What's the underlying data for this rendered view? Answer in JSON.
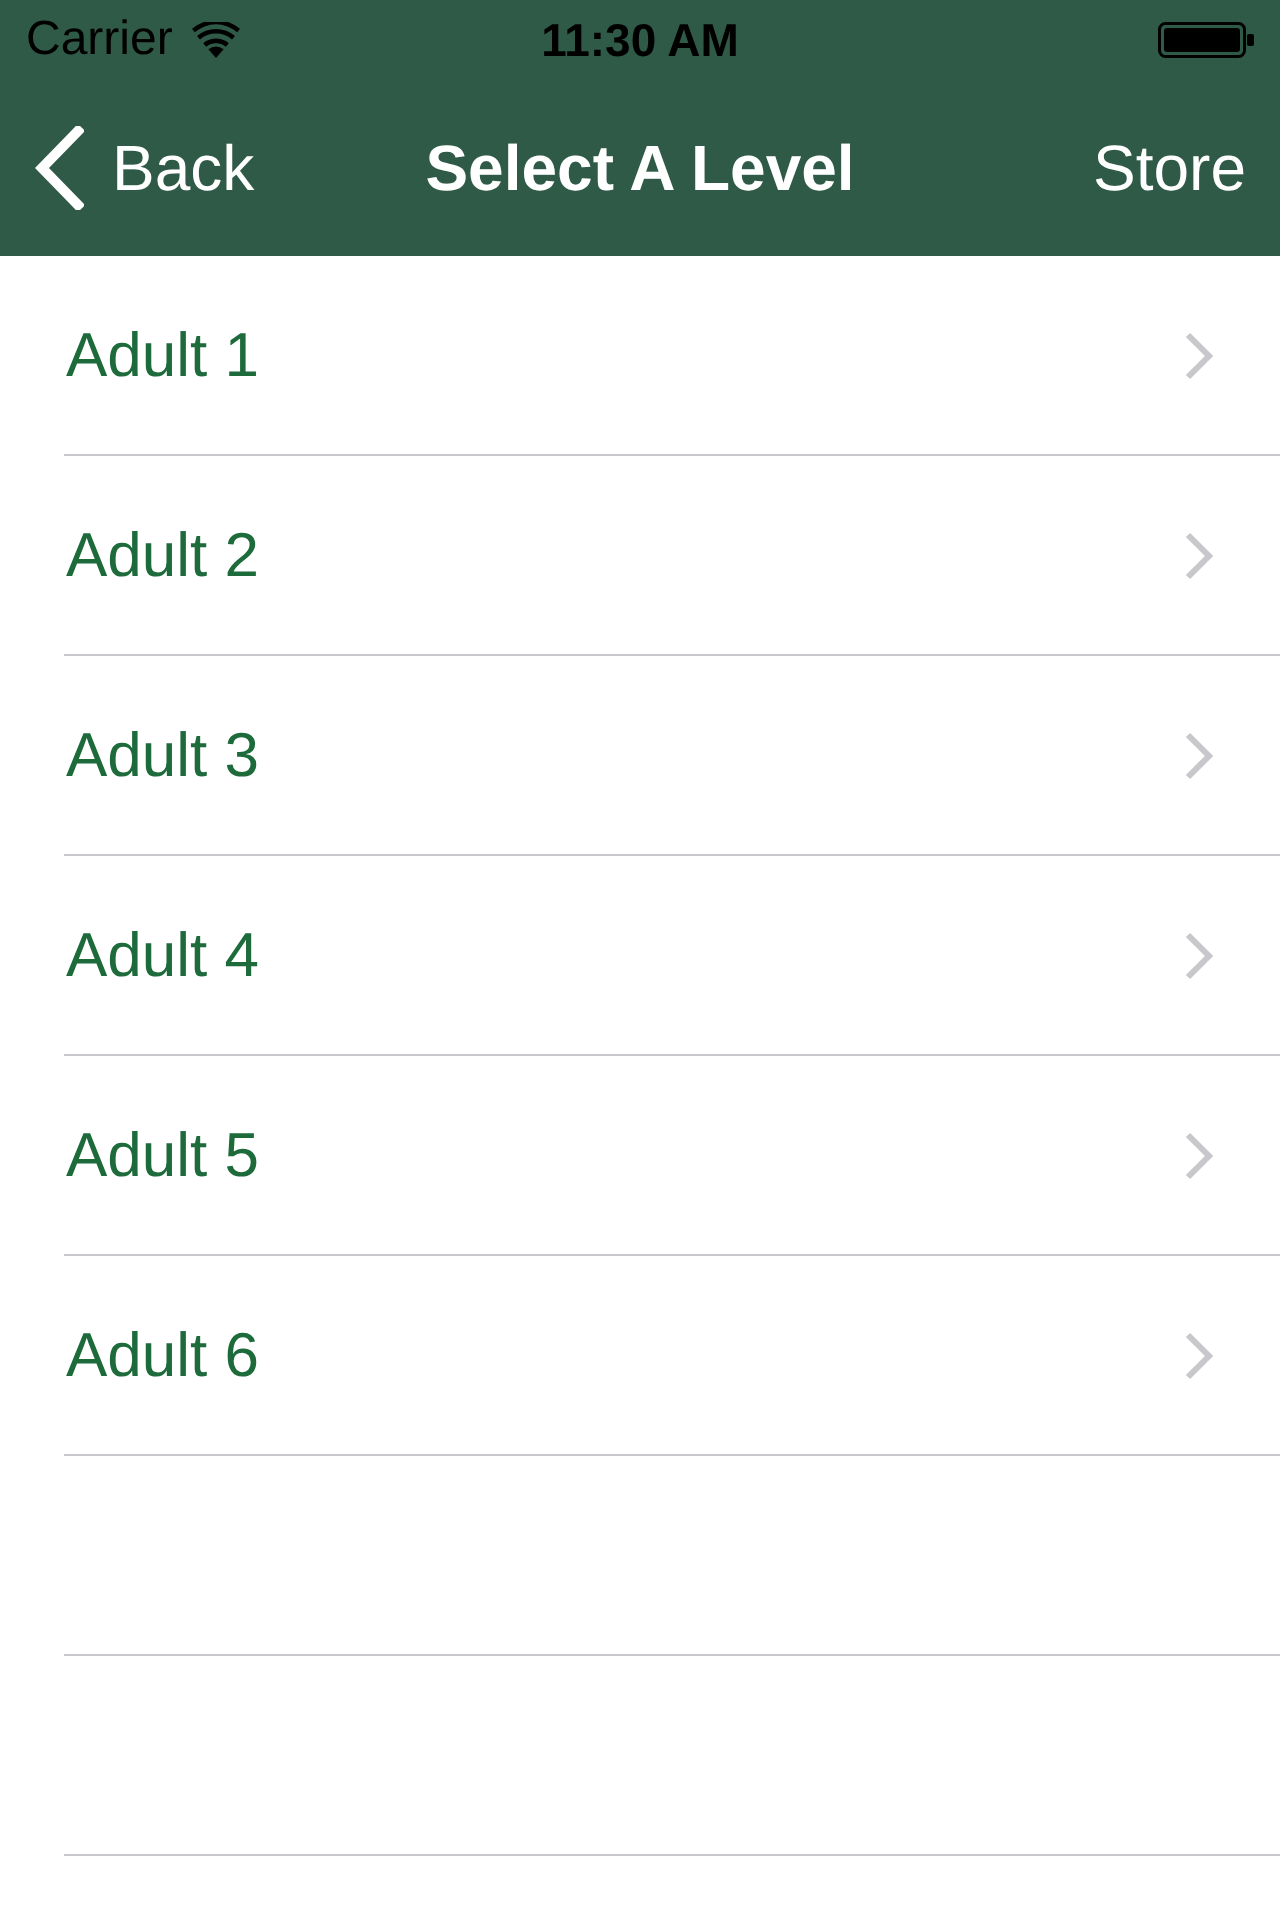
{
  "status_bar": {
    "carrier": "Carrier",
    "time": "11:30 AM"
  },
  "nav_bar": {
    "back": "Back",
    "title": "Select A Level",
    "action": "Store"
  },
  "levels": [
    {
      "label": "Adult 1"
    },
    {
      "label": "Adult 2"
    },
    {
      "label": "Adult 3"
    },
    {
      "label": "Adult 4"
    },
    {
      "label": "Adult 5"
    },
    {
      "label": "Adult 6"
    }
  ]
}
